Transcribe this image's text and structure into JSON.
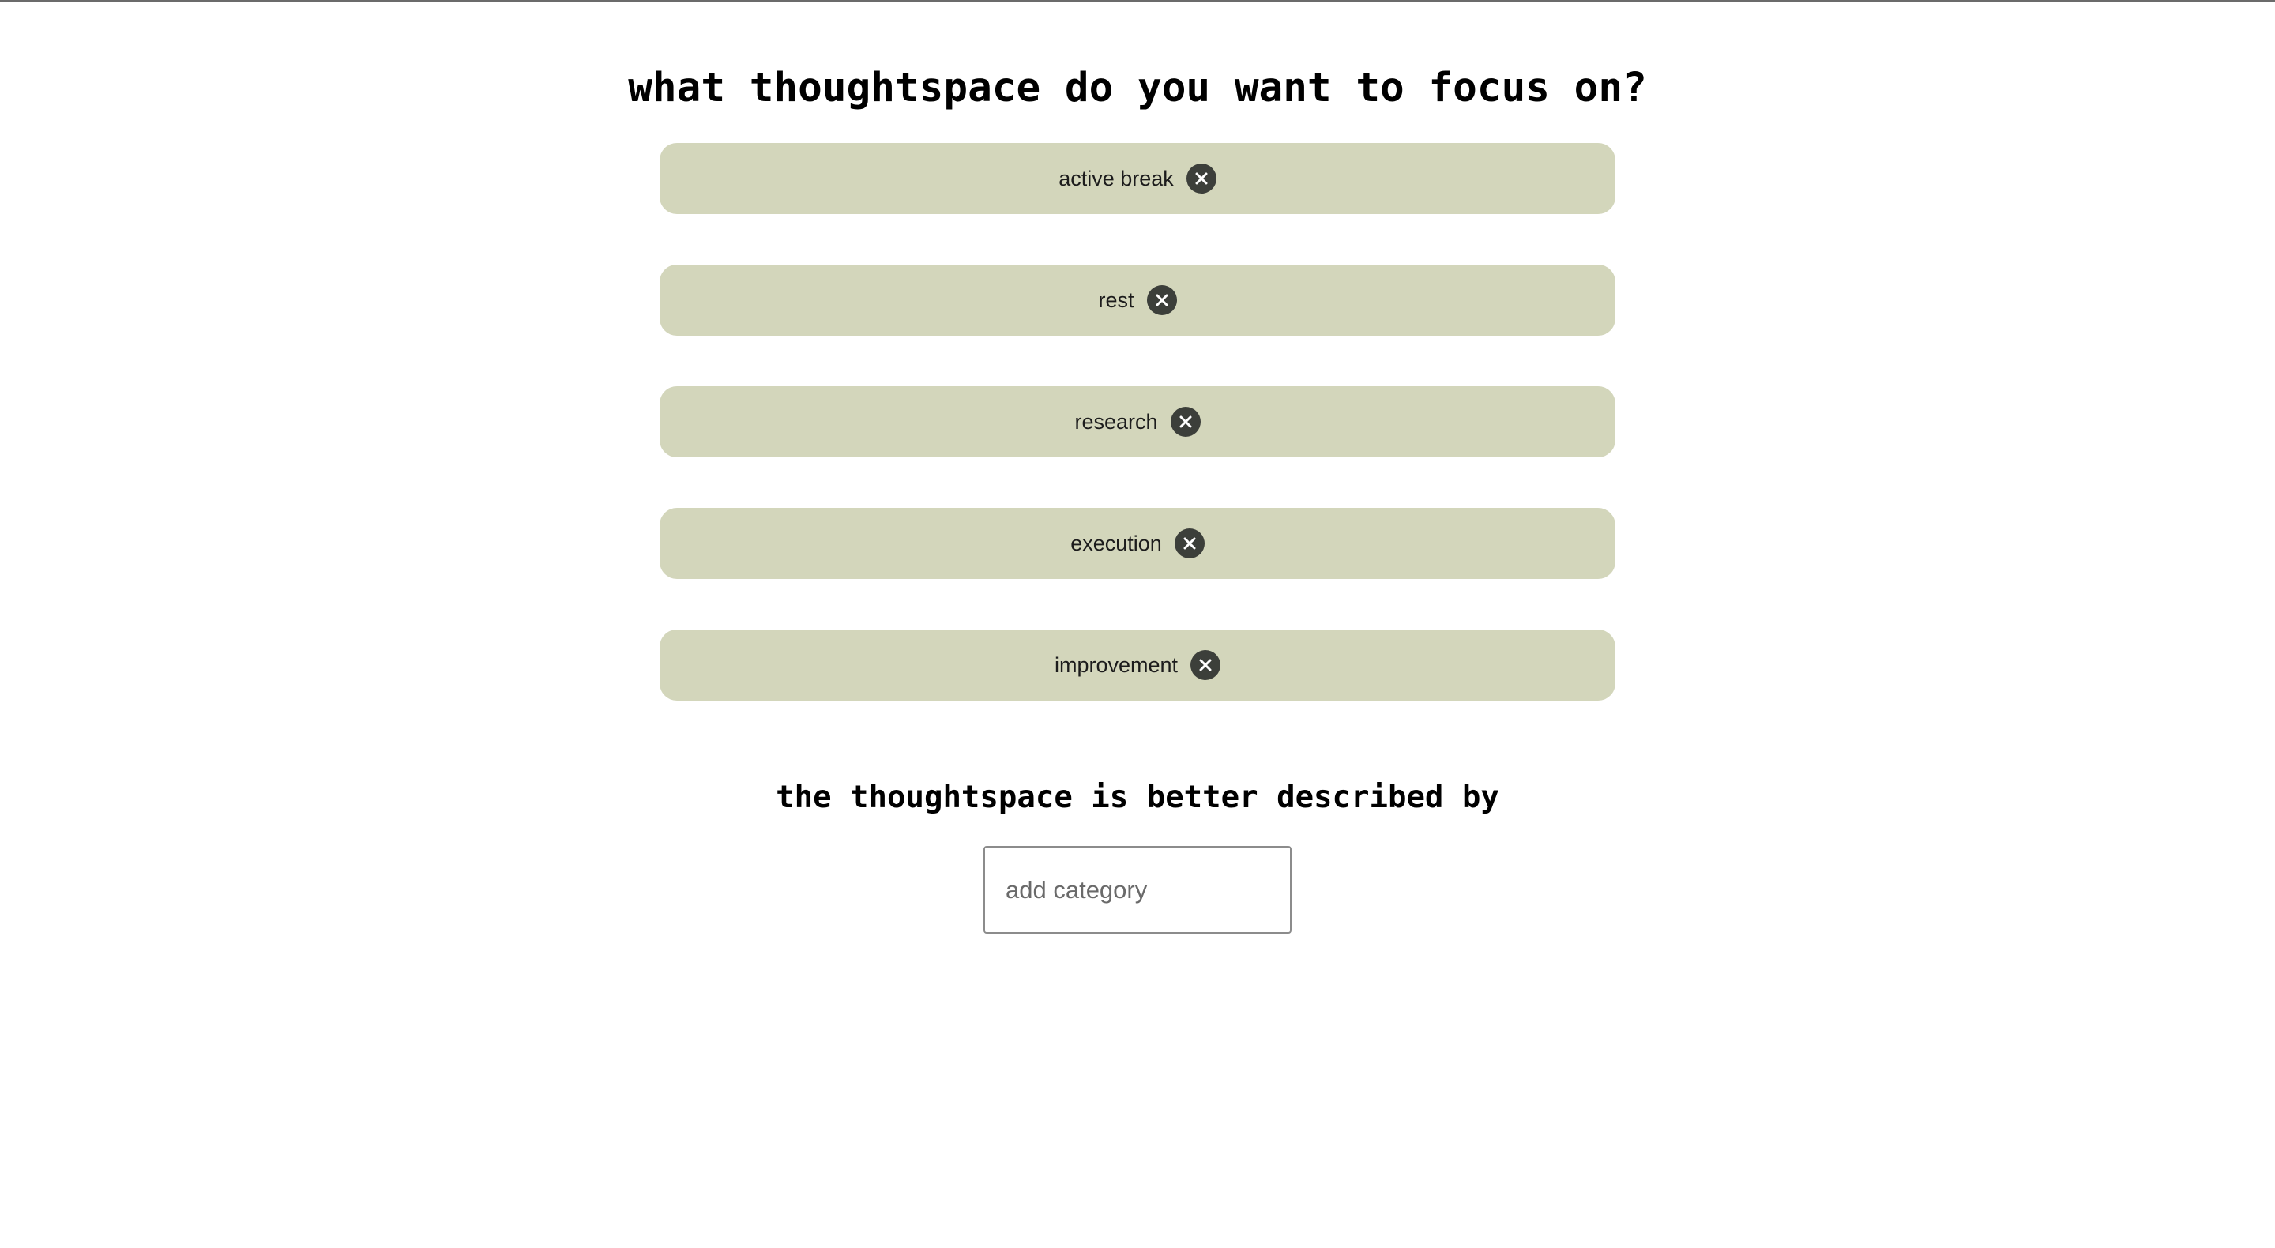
{
  "header": {
    "title": "what thoughtspace do you want to focus on?"
  },
  "categories": [
    {
      "label": "active break",
      "remove_icon": "close-circle-icon"
    },
    {
      "label": "rest",
      "remove_icon": "close-circle-icon"
    },
    {
      "label": "research",
      "remove_icon": "close-circle-icon"
    },
    {
      "label": "execution",
      "remove_icon": "close-circle-icon"
    },
    {
      "label": "improvement",
      "remove_icon": "close-circle-icon"
    }
  ],
  "add_section": {
    "title": "the thoughtspace is better described by",
    "input_placeholder": "add category",
    "input_value": ""
  },
  "colors": {
    "pill_background": "#d3d6bb",
    "remove_button": "#3c3f3a",
    "text": "#000000"
  }
}
